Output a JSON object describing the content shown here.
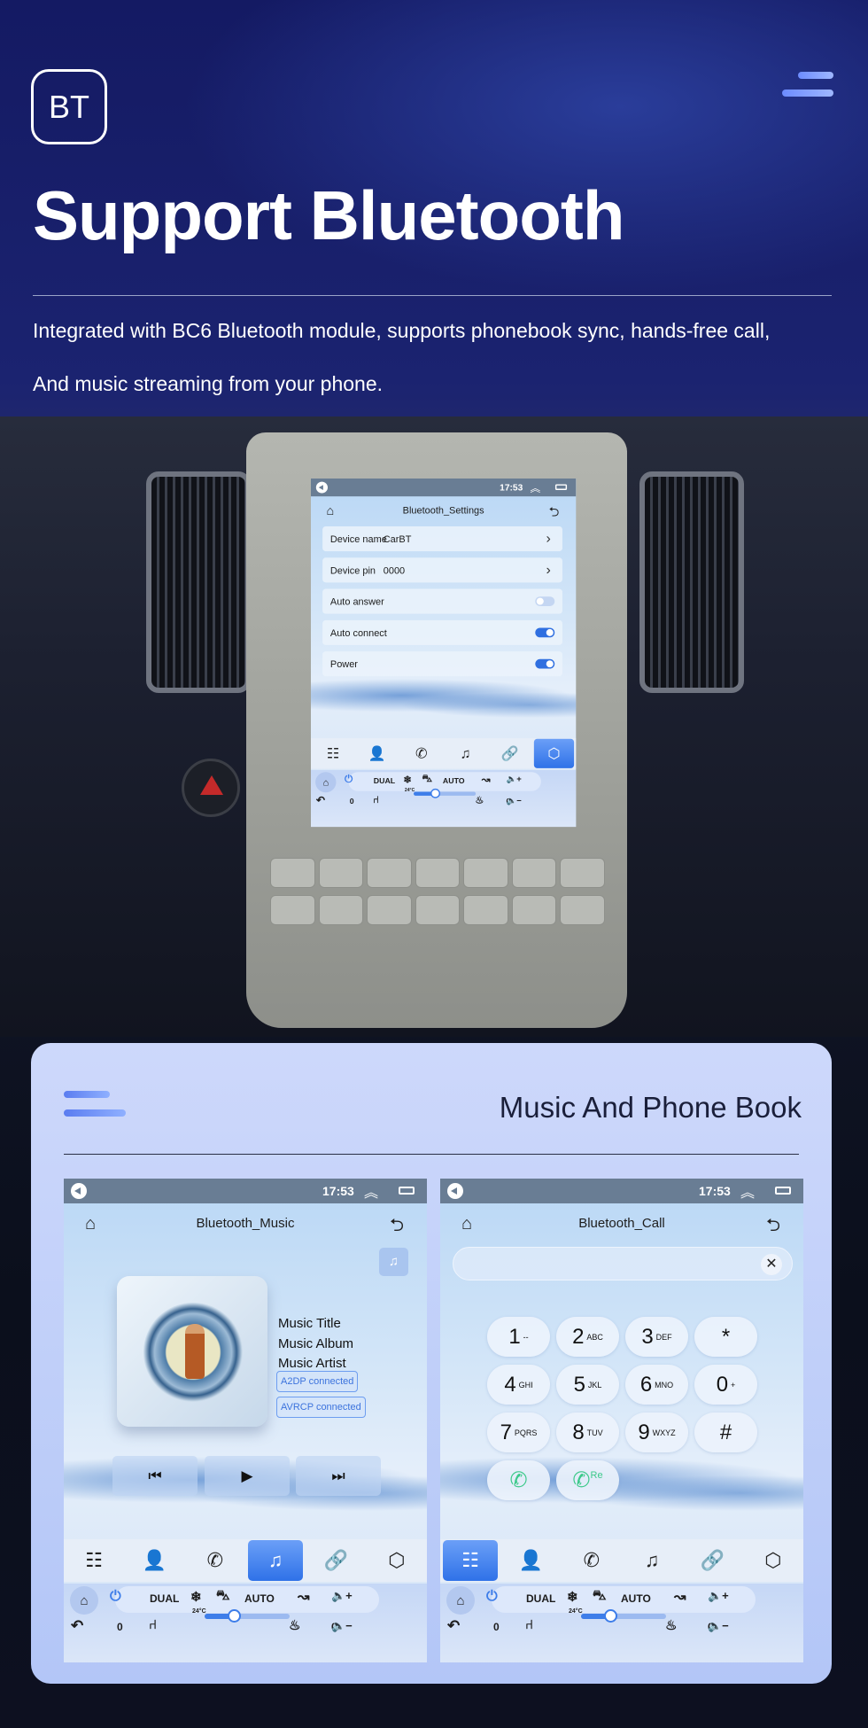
{
  "hero": {
    "badge": "BT",
    "title": "Support Bluetooth",
    "desc_line1": "Integrated with BC6 Bluetooth module, supports phonebook sync, hands-free call,",
    "desc_line2": "And music streaming from your phone."
  },
  "card": {
    "title": "Music And Phone Book"
  },
  "common": {
    "time": "17:53",
    "climate": {
      "dual": "DUAL",
      "auto": "AUTO",
      "temp": "24°C",
      "left_level": "0",
      "right_level": "0"
    },
    "tabs": [
      {
        "icon": "dialpad-icon",
        "glyph": "☷"
      },
      {
        "icon": "contacts-icon",
        "glyph": "👤"
      },
      {
        "icon": "phone-icon",
        "glyph": "✆"
      },
      {
        "icon": "music-icon",
        "glyph": "♫"
      },
      {
        "icon": "link-icon",
        "glyph": "🔗"
      },
      {
        "icon": "settings-icon",
        "glyph": "⬡"
      }
    ]
  },
  "settings": {
    "title": "Bluetooth_Settings",
    "rows": [
      {
        "label": "Device name",
        "value": "CarBT",
        "type": "link"
      },
      {
        "label": "Device pin",
        "value": "0000",
        "type": "link"
      },
      {
        "label": "Auto answer",
        "type": "toggle",
        "on": false
      },
      {
        "label": "Auto connect",
        "type": "toggle",
        "on": true
      },
      {
        "label": "Power",
        "type": "toggle",
        "on": true
      }
    ],
    "active_tab": 5
  },
  "music": {
    "title": "Bluetooth_Music",
    "track_title": "Music Title",
    "album": "Music Album",
    "artist": "Music Artist",
    "a2dp": "A2DP  connected",
    "avrcp": "AVRCP connected",
    "active_tab": 3
  },
  "call": {
    "title": "Bluetooth_Call",
    "input_value": "",
    "keys": [
      {
        "d": "1",
        "l": "--"
      },
      {
        "d": "2",
        "l": "ABC"
      },
      {
        "d": "3",
        "l": "DEF"
      },
      {
        "d": "*",
        "l": ""
      },
      {
        "d": "4",
        "l": "GHI"
      },
      {
        "d": "5",
        "l": "JKL"
      },
      {
        "d": "6",
        "l": "MNO"
      },
      {
        "d": "0",
        "l": "+"
      },
      {
        "d": "7",
        "l": "PQRS"
      },
      {
        "d": "8",
        "l": "TUV"
      },
      {
        "d": "9",
        "l": "WXYZ"
      },
      {
        "d": "#",
        "l": ""
      }
    ],
    "redial_label": "Re",
    "active_tab": 0
  },
  "colors": {
    "accent": "#2f72e8",
    "call_green": "#3cc98a",
    "status_bar": "#697d94"
  },
  "fan_level": 0.35
}
